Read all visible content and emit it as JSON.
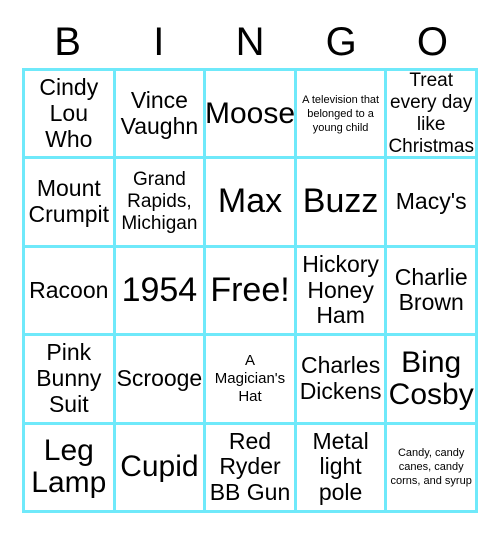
{
  "card": {
    "type": "bingo-card",
    "header_letters": [
      "B",
      "I",
      "N",
      "G",
      "O"
    ],
    "border_color": "#6FE9FA",
    "background_color": "#FFFFFF",
    "text_color": "#000000",
    "grid_size": "5x5",
    "free_space": "Free!",
    "cells": [
      {
        "text": "Cindy Lou Who",
        "size": "md"
      },
      {
        "text": "Vince Vaughn",
        "size": "md"
      },
      {
        "text": "Moose",
        "size": "lg"
      },
      {
        "text": "A television that belonged to a young child",
        "size": "xxs"
      },
      {
        "text": "Treat every day like Christmas",
        "size": "sm"
      },
      {
        "text": "Mount Crumpit",
        "size": "md"
      },
      {
        "text": "Grand Rapids, Michigan",
        "size": "sm"
      },
      {
        "text": "Max",
        "size": "xl"
      },
      {
        "text": "Buzz",
        "size": "xl"
      },
      {
        "text": "Macy's",
        "size": "md"
      },
      {
        "text": "Racoon",
        "size": "md"
      },
      {
        "text": "1954",
        "size": "xl"
      },
      {
        "text": "Free!",
        "size": "xl"
      },
      {
        "text": "Hickory Honey Ham",
        "size": "md"
      },
      {
        "text": "Charlie Brown",
        "size": "md"
      },
      {
        "text": "Pink Bunny Suit",
        "size": "md"
      },
      {
        "text": "Scrooge",
        "size": "md"
      },
      {
        "text": "A Magician's Hat",
        "size": "xs"
      },
      {
        "text": "Charles Dickens",
        "size": "md"
      },
      {
        "text": "Bing Cosby",
        "size": "lg"
      },
      {
        "text": "Leg Lamp",
        "size": "lg"
      },
      {
        "text": "Cupid",
        "size": "lg"
      },
      {
        "text": "Red Ryder BB Gun",
        "size": "md"
      },
      {
        "text": "Metal light pole",
        "size": "md"
      },
      {
        "text": "Candy, candy canes, candy corns, and syrup",
        "size": "xxs"
      }
    ]
  }
}
